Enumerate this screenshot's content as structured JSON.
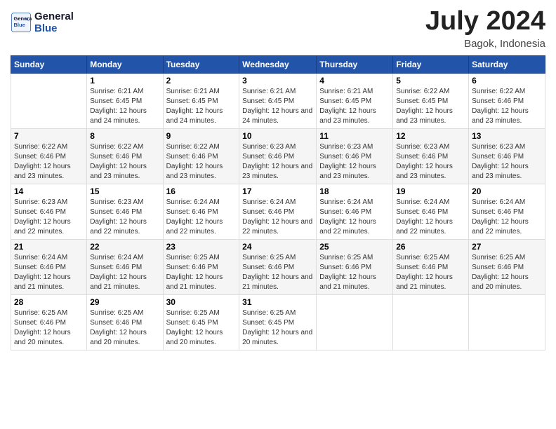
{
  "header": {
    "logo_line1": "General",
    "logo_line2": "Blue",
    "month_title": "July 2024",
    "location": "Bagok, Indonesia"
  },
  "weekdays": [
    "Sunday",
    "Monday",
    "Tuesday",
    "Wednesday",
    "Thursday",
    "Friday",
    "Saturday"
  ],
  "weeks": [
    [
      {
        "day": "",
        "sunrise": "",
        "sunset": "",
        "daylight": ""
      },
      {
        "day": "1",
        "sunrise": "6:21 AM",
        "sunset": "6:45 PM",
        "daylight": "12 hours and 24 minutes."
      },
      {
        "day": "2",
        "sunrise": "6:21 AM",
        "sunset": "6:45 PM",
        "daylight": "12 hours and 24 minutes."
      },
      {
        "day": "3",
        "sunrise": "6:21 AM",
        "sunset": "6:45 PM",
        "daylight": "12 hours and 24 minutes."
      },
      {
        "day": "4",
        "sunrise": "6:21 AM",
        "sunset": "6:45 PM",
        "daylight": "12 hours and 23 minutes."
      },
      {
        "day": "5",
        "sunrise": "6:22 AM",
        "sunset": "6:45 PM",
        "daylight": "12 hours and 23 minutes."
      },
      {
        "day": "6",
        "sunrise": "6:22 AM",
        "sunset": "6:46 PM",
        "daylight": "12 hours and 23 minutes."
      }
    ],
    [
      {
        "day": "7",
        "sunrise": "6:22 AM",
        "sunset": "6:46 PM",
        "daylight": "12 hours and 23 minutes."
      },
      {
        "day": "8",
        "sunrise": "6:22 AM",
        "sunset": "6:46 PM",
        "daylight": "12 hours and 23 minutes."
      },
      {
        "day": "9",
        "sunrise": "6:22 AM",
        "sunset": "6:46 PM",
        "daylight": "12 hours and 23 minutes."
      },
      {
        "day": "10",
        "sunrise": "6:23 AM",
        "sunset": "6:46 PM",
        "daylight": "12 hours and 23 minutes."
      },
      {
        "day": "11",
        "sunrise": "6:23 AM",
        "sunset": "6:46 PM",
        "daylight": "12 hours and 23 minutes."
      },
      {
        "day": "12",
        "sunrise": "6:23 AM",
        "sunset": "6:46 PM",
        "daylight": "12 hours and 23 minutes."
      },
      {
        "day": "13",
        "sunrise": "6:23 AM",
        "sunset": "6:46 PM",
        "daylight": "12 hours and 23 minutes."
      }
    ],
    [
      {
        "day": "14",
        "sunrise": "6:23 AM",
        "sunset": "6:46 PM",
        "daylight": "12 hours and 22 minutes."
      },
      {
        "day": "15",
        "sunrise": "6:23 AM",
        "sunset": "6:46 PM",
        "daylight": "12 hours and 22 minutes."
      },
      {
        "day": "16",
        "sunrise": "6:24 AM",
        "sunset": "6:46 PM",
        "daylight": "12 hours and 22 minutes."
      },
      {
        "day": "17",
        "sunrise": "6:24 AM",
        "sunset": "6:46 PM",
        "daylight": "12 hours and 22 minutes."
      },
      {
        "day": "18",
        "sunrise": "6:24 AM",
        "sunset": "6:46 PM",
        "daylight": "12 hours and 22 minutes."
      },
      {
        "day": "19",
        "sunrise": "6:24 AM",
        "sunset": "6:46 PM",
        "daylight": "12 hours and 22 minutes."
      },
      {
        "day": "20",
        "sunrise": "6:24 AM",
        "sunset": "6:46 PM",
        "daylight": "12 hours and 22 minutes."
      }
    ],
    [
      {
        "day": "21",
        "sunrise": "6:24 AM",
        "sunset": "6:46 PM",
        "daylight": "12 hours and 21 minutes."
      },
      {
        "day": "22",
        "sunrise": "6:24 AM",
        "sunset": "6:46 PM",
        "daylight": "12 hours and 21 minutes."
      },
      {
        "day": "23",
        "sunrise": "6:25 AM",
        "sunset": "6:46 PM",
        "daylight": "12 hours and 21 minutes."
      },
      {
        "day": "24",
        "sunrise": "6:25 AM",
        "sunset": "6:46 PM",
        "daylight": "12 hours and 21 minutes."
      },
      {
        "day": "25",
        "sunrise": "6:25 AM",
        "sunset": "6:46 PM",
        "daylight": "12 hours and 21 minutes."
      },
      {
        "day": "26",
        "sunrise": "6:25 AM",
        "sunset": "6:46 PM",
        "daylight": "12 hours and 21 minutes."
      },
      {
        "day": "27",
        "sunrise": "6:25 AM",
        "sunset": "6:46 PM",
        "daylight": "12 hours and 20 minutes."
      }
    ],
    [
      {
        "day": "28",
        "sunrise": "6:25 AM",
        "sunset": "6:46 PM",
        "daylight": "12 hours and 20 minutes."
      },
      {
        "day": "29",
        "sunrise": "6:25 AM",
        "sunset": "6:46 PM",
        "daylight": "12 hours and 20 minutes."
      },
      {
        "day": "30",
        "sunrise": "6:25 AM",
        "sunset": "6:45 PM",
        "daylight": "12 hours and 20 minutes."
      },
      {
        "day": "31",
        "sunrise": "6:25 AM",
        "sunset": "6:45 PM",
        "daylight": "12 hours and 20 minutes."
      },
      {
        "day": "",
        "sunrise": "",
        "sunset": "",
        "daylight": ""
      },
      {
        "day": "",
        "sunrise": "",
        "sunset": "",
        "daylight": ""
      },
      {
        "day": "",
        "sunrise": "",
        "sunset": "",
        "daylight": ""
      }
    ]
  ]
}
